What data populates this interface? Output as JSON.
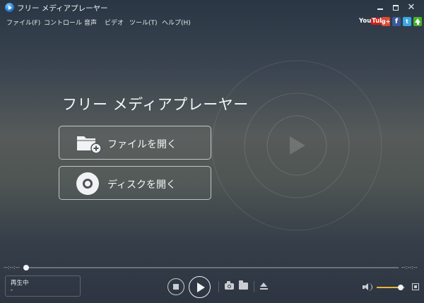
{
  "window": {
    "title": "フリー メディアプレーヤー"
  },
  "menu": {
    "items": [
      "ファイル(F)",
      "コントロール",
      "音声",
      "ビデオ",
      "ツール(T)",
      "ヘルプ(H)"
    ]
  },
  "social": {
    "youtube": "You",
    "youtube_tube": "Tube",
    "googleplus": "g+",
    "facebook": "f",
    "twitter": "t",
    "icons": [
      "youtube-icon",
      "googleplus-icon",
      "facebook-icon",
      "twitter-icon",
      "upload-icon"
    ]
  },
  "main": {
    "title": "フリー メディアプレーヤー",
    "open_file_label": "ファイルを開く",
    "open_disc_label": "ディスクを開く"
  },
  "seek": {
    "elapsed": "--:--:--",
    "total": "--:--:--",
    "progress": 0
  },
  "status": {
    "label": "再生中",
    "value": "-"
  },
  "volume": {
    "level": 0.85,
    "accent_color": "#e8b638"
  },
  "colors": {
    "background_top": "#2a3644",
    "background_mid": "#565b5a",
    "text": "#f4f5f6",
    "volume_accent": "#e8b638",
    "youtube_red": "#d2201c",
    "facebook_blue": "#3b5998",
    "twitter_blue": "#39a7e0",
    "upload_green": "#43b02a"
  }
}
